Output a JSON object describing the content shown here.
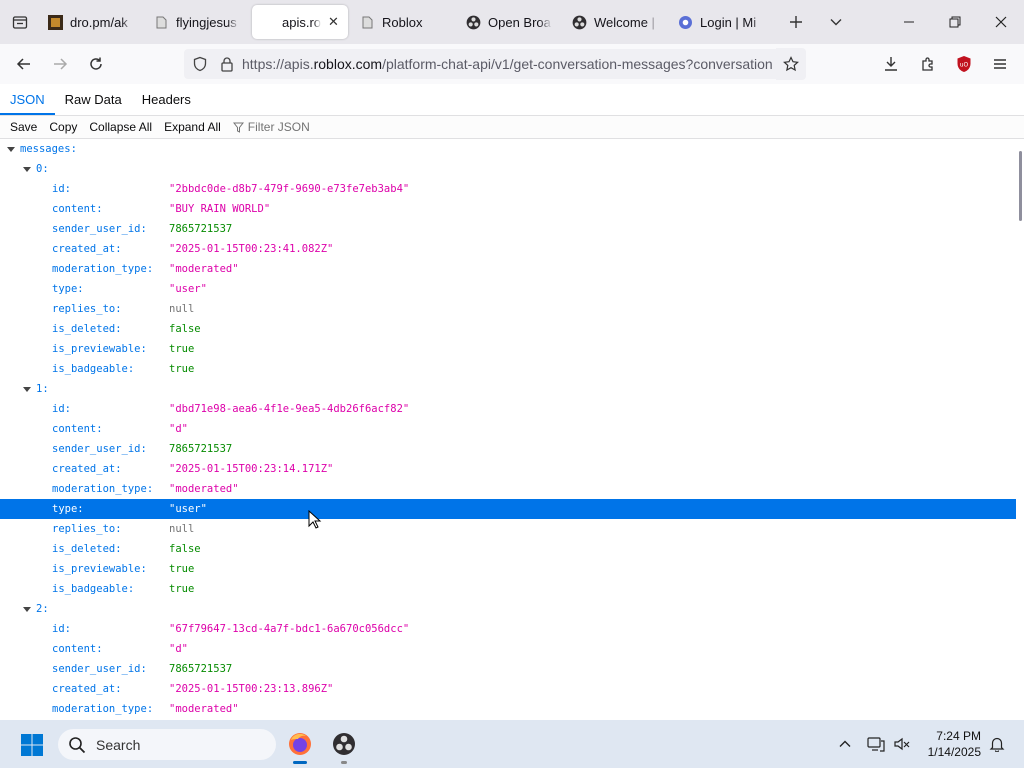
{
  "tabs": [
    {
      "label": "dro.pm/ak",
      "icon": "thumbnail-icon",
      "active": false
    },
    {
      "label": "flyingjesus",
      "icon": "page-icon",
      "active": false
    },
    {
      "label": "apis.roblox",
      "icon": "",
      "active": true
    },
    {
      "label": "Roblox",
      "icon": "page-icon",
      "active": false
    },
    {
      "label": "Open Broa",
      "icon": "obs-icon",
      "active": false
    },
    {
      "label": "Welcome |",
      "icon": "obs-icon",
      "active": false
    },
    {
      "label": "Login | Mi",
      "icon": "login-icon",
      "active": false
    }
  ],
  "url": {
    "prefix": "https://apis.",
    "host": "roblox.com",
    "path": "/platform-chat-api/v1/get-conversation-messages?conversation"
  },
  "viewer": {
    "tabs": [
      "JSON",
      "Raw Data",
      "Headers"
    ],
    "selected_tab": "JSON",
    "toolbar": {
      "save": "Save",
      "copy": "Copy",
      "collapse": "Collapse All",
      "expand": "Expand All",
      "filter": "Filter JSON"
    }
  },
  "json_root_key": "messages:",
  "messages": [
    {
      "index": "0:",
      "fields": [
        {
          "key": "id:",
          "value": "\"2bbdc0de-d8b7-479f-9690-e73fe7eb3ab4\"",
          "type": "str"
        },
        {
          "key": "content:",
          "value": "\"BUY RAIN WORLD\"",
          "type": "str"
        },
        {
          "key": "sender_user_id:",
          "value": "7865721537",
          "type": "num"
        },
        {
          "key": "created_at:",
          "value": "\"2025-01-15T00:23:41.082Z\"",
          "type": "str"
        },
        {
          "key": "moderation_type:",
          "value": "\"moderated\"",
          "type": "str"
        },
        {
          "key": "type:",
          "value": "\"user\"",
          "type": "str"
        },
        {
          "key": "replies_to:",
          "value": "null",
          "type": "null"
        },
        {
          "key": "is_deleted:",
          "value": "false",
          "type": "bool"
        },
        {
          "key": "is_previewable:",
          "value": "true",
          "type": "bool"
        },
        {
          "key": "is_badgeable:",
          "value": "true",
          "type": "bool"
        }
      ]
    },
    {
      "index": "1:",
      "fields": [
        {
          "key": "id:",
          "value": "\"dbd71e98-aea6-4f1e-9ea5-4db26f6acf82\"",
          "type": "str"
        },
        {
          "key": "content:",
          "value": "\"d\"",
          "type": "str"
        },
        {
          "key": "sender_user_id:",
          "value": "7865721537",
          "type": "num"
        },
        {
          "key": "created_at:",
          "value": "\"2025-01-15T00:23:14.171Z\"",
          "type": "str"
        },
        {
          "key": "moderation_type:",
          "value": "\"moderated\"",
          "type": "str"
        },
        {
          "key": "type:",
          "value": "\"user\"",
          "type": "str",
          "highlighted": true
        },
        {
          "key": "replies_to:",
          "value": "null",
          "type": "null"
        },
        {
          "key": "is_deleted:",
          "value": "false",
          "type": "bool"
        },
        {
          "key": "is_previewable:",
          "value": "true",
          "type": "bool"
        },
        {
          "key": "is_badgeable:",
          "value": "true",
          "type": "bool"
        }
      ]
    },
    {
      "index": "2:",
      "fields": [
        {
          "key": "id:",
          "value": "\"67f79647-13cd-4a7f-bdc1-6a670c056dcc\"",
          "type": "str"
        },
        {
          "key": "content:",
          "value": "\"d\"",
          "type": "str"
        },
        {
          "key": "sender_user_id:",
          "value": "7865721537",
          "type": "num"
        },
        {
          "key": "created_at:",
          "value": "\"2025-01-15T00:23:13.896Z\"",
          "type": "str"
        },
        {
          "key": "moderation_type:",
          "value": "\"moderated\"",
          "type": "str"
        }
      ]
    }
  ],
  "taskbar": {
    "search_label": "Search",
    "time": "7:24 PM",
    "date": "1/14/2025"
  },
  "colors": {
    "accent": "#0074e8",
    "string": "#dd00a9",
    "number": "#058b00",
    "null": "#737373"
  }
}
